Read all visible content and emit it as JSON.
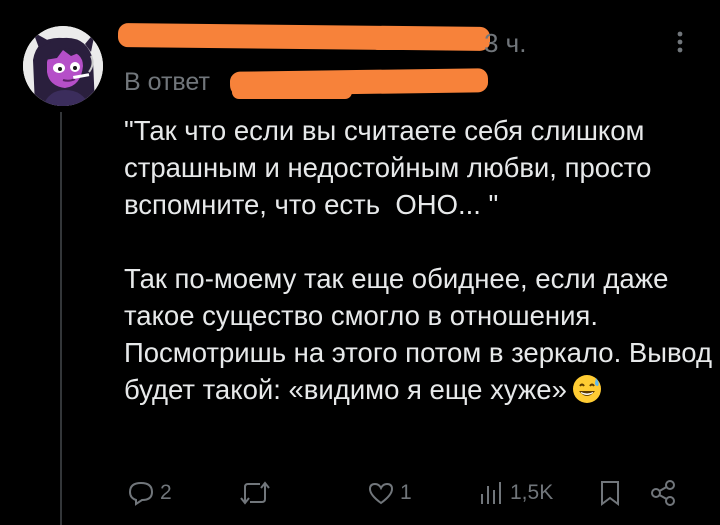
{
  "tweet": {
    "time": "3 ч.",
    "reply_label": "В ответ",
    "text": "\"Так что если вы считаете себя слишком страшным и недостойным любви, просто вспомните, что есть  ОНО... \"\n\nТак по-моему так еще обиднее, если даже такое существо смогло в отношения. Посмотришь на этого потом в зеркало. Вывод будет такой: «видимо я еще хуже»",
    "emoji": "sweat-smile-emoji"
  },
  "actions": {
    "replies": "2",
    "retweets": "",
    "likes": "1",
    "views": "1,5K"
  },
  "colors": {
    "background": "#000000",
    "text": "#e7e9ea",
    "muted": "#71767b",
    "redaction": "#f7823a",
    "thread_line": "#333639"
  },
  "icons": {
    "more": "more-vertical-icon",
    "reply": "reply-icon",
    "retweet": "retweet-icon",
    "like": "heart-icon",
    "views": "views-icon",
    "bookmark": "bookmark-icon",
    "share": "share-icon"
  }
}
